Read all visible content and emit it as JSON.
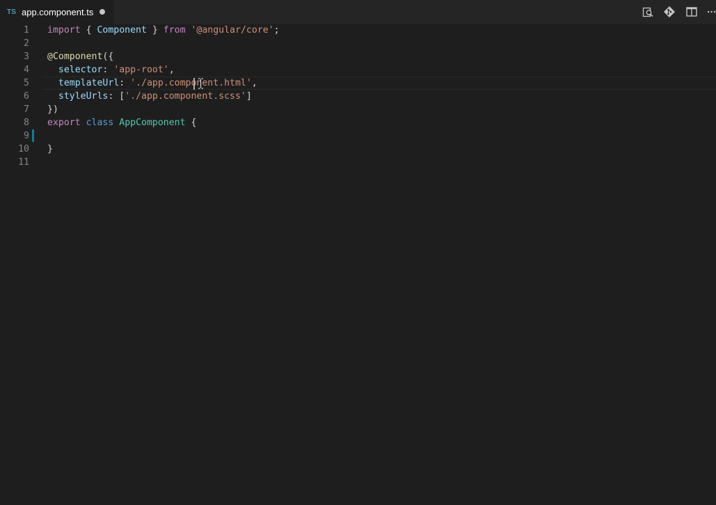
{
  "tab": {
    "language_badge": "TS",
    "filename": "app.component.ts",
    "dirty": true
  },
  "toolbar": {
    "icons": [
      "open-changes-icon",
      "git-compare-icon",
      "split-editor-icon",
      "more-actions-icon"
    ],
    "more_label": "···"
  },
  "editor": {
    "lines": [
      {
        "n": "1",
        "tokens": [
          {
            "t": "import",
            "c": "kw"
          },
          {
            "t": " { ",
            "c": "pu"
          },
          {
            "t": "Component",
            "c": "pr"
          },
          {
            "t": " } ",
            "c": "pu"
          },
          {
            "t": "from",
            "c": "kw"
          },
          {
            "t": " ",
            "c": "pu"
          },
          {
            "t": "'@angular/core'",
            "c": "st"
          },
          {
            "t": ";",
            "c": "pu"
          }
        ]
      },
      {
        "n": "2",
        "tokens": []
      },
      {
        "n": "3",
        "tokens": [
          {
            "t": "@Component",
            "c": "fn"
          },
          {
            "t": "({",
            "c": "pu"
          }
        ]
      },
      {
        "n": "4",
        "tokens": [
          {
            "t": "  ",
            "c": "pu"
          },
          {
            "t": "selector",
            "c": "pr"
          },
          {
            "t": ": ",
            "c": "pu"
          },
          {
            "t": "'app-root'",
            "c": "st"
          },
          {
            "t": ",",
            "c": "pu"
          }
        ]
      },
      {
        "n": "5",
        "tokens": [
          {
            "t": "  ",
            "c": "pu"
          },
          {
            "t": "templateUrl",
            "c": "pr"
          },
          {
            "t": ": ",
            "c": "pu"
          },
          {
            "t": "'./app.component.html'",
            "c": "st"
          },
          {
            "t": ",",
            "c": "pu"
          }
        ]
      },
      {
        "n": "6",
        "tokens": [
          {
            "t": "  ",
            "c": "pu"
          },
          {
            "t": "styleUrls",
            "c": "pr"
          },
          {
            "t": ": [",
            "c": "pu"
          },
          {
            "t": "'./app.component.scss'",
            "c": "st"
          },
          {
            "t": "]",
            "c": "pu"
          }
        ]
      },
      {
        "n": "7",
        "tokens": [
          {
            "t": "})",
            "c": "pu"
          }
        ]
      },
      {
        "n": "8",
        "tokens": [
          {
            "t": "export",
            "c": "kw"
          },
          {
            "t": " ",
            "c": "pu"
          },
          {
            "t": "class",
            "c": "kb"
          },
          {
            "t": " ",
            "c": "pu"
          },
          {
            "t": "AppComponent",
            "c": "ty"
          },
          {
            "t": " {",
            "c": "pu"
          }
        ]
      },
      {
        "n": "9",
        "tokens": []
      },
      {
        "n": "10",
        "tokens": [
          {
            "t": "}",
            "c": "pu"
          }
        ]
      },
      {
        "n": "11",
        "tokens": []
      }
    ]
  },
  "colors": {
    "background": "#1e1e1e",
    "tabbar": "#252526",
    "keyword": "#c586c0",
    "storage": "#569cd6",
    "type": "#4ec9b0",
    "decorator": "#dcdcaa",
    "property": "#9cdcfe",
    "string": "#ce9178",
    "line_number": "#858585",
    "modified_gutter": "#0c7d9d"
  }
}
